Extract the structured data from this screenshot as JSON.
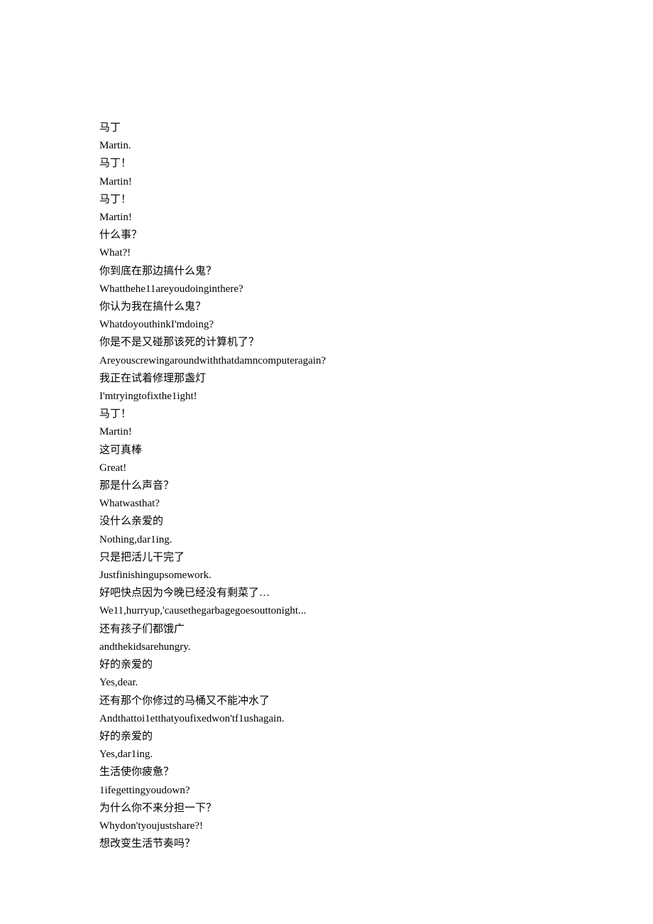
{
  "lines": [
    "马丁",
    "Martin.",
    "马丁！",
    "Martin!",
    "马丁！",
    "Martin!",
    "什么事？",
    "What?!",
    "你到底在那边搞什么鬼？",
    "Whatthehe11areyoudoinginthere?",
    "你认为我在搞什么鬼？",
    "WhatdoyouthinkI'mdoing?",
    "你是不是又碰那该死的计算机了？",
    "Areyouscrewingaroundwiththatdamncomputeragain?",
    "我正在试着修理那盏灯",
    "I'mtryingtofixthe1ight!",
    "马丁！",
    "Martin!",
    "这可真棒",
    "Great!",
    "那是什么声音？",
    "Whatwasthat?",
    "没什么亲爱的",
    "Nothing,dar1ing.",
    "只是把活儿干完了",
    "Justfinishingupsomework.",
    "好吧快点因为今晚已经没有剩菜了…",
    "We11,hurryup,'causethegarbagegoesouttonight...",
    "还有孩子们都饿广",
    "andthekidsarehungry.",
    "好的亲爱的",
    "Yes,dear.",
    "还有那个你修过的马桶又不能冲水了",
    "Andthattoi1etthatyoufixedwon'tf1ushagain.",
    "好的亲爱的",
    "Yes,dar1ing.",
    "生活使你疲惫？",
    "1ifegettingyoudown?",
    "为什么你不来分担一下？",
    "Whydon'tyoujustshare?!",
    "想改变生活节奏吗？"
  ]
}
